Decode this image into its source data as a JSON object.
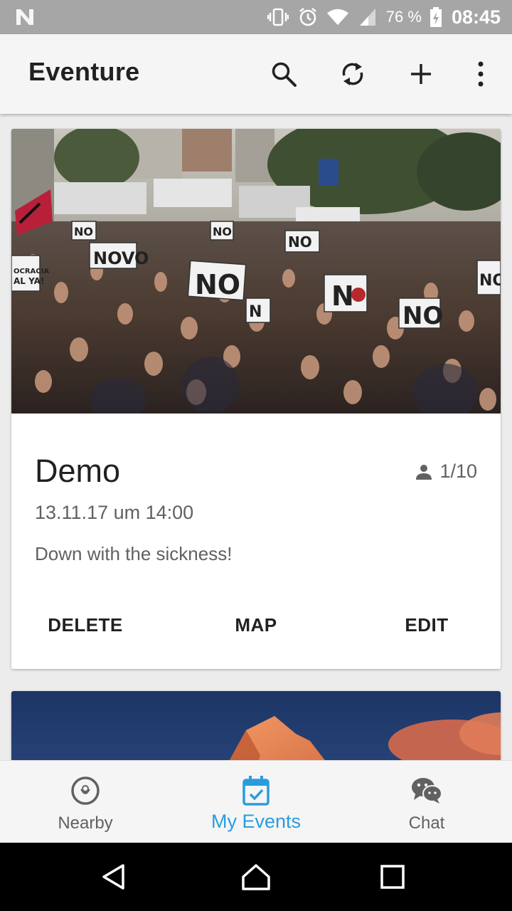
{
  "status_bar": {
    "battery_percent": "76 %",
    "time": "08:45",
    "icons": [
      "n-notification-icon",
      "vibrate-icon",
      "alarm-icon",
      "wifi-icon",
      "signal-icon",
      "battery-charging-icon"
    ]
  },
  "app_bar": {
    "title": "Eventure",
    "actions": [
      "search-icon",
      "sync-icon",
      "add-icon",
      "more-vert-icon"
    ]
  },
  "events": [
    {
      "title": "Demo",
      "participants": "1/10",
      "date": "13.11.17 um 14:00",
      "description": "Down with the sickness!",
      "buttons": {
        "delete": "DELETE",
        "map": "MAP",
        "edit": "EDIT"
      },
      "image": "crowd-protest-photo"
    },
    {
      "image": "mountain-peak-photo"
    }
  ],
  "bottom_nav": {
    "items": [
      {
        "label": "Nearby",
        "icon": "location-pin-icon",
        "active": false
      },
      {
        "label": "My Events",
        "icon": "calendar-check-icon",
        "active": true
      },
      {
        "label": "Chat",
        "icon": "chat-bubbles-icon",
        "active": false
      }
    ]
  },
  "colors": {
    "accent": "#2a9cde",
    "status_bar": "#a6a6a6",
    "app_bar": "#f5f5f5",
    "background": "#ececec"
  }
}
